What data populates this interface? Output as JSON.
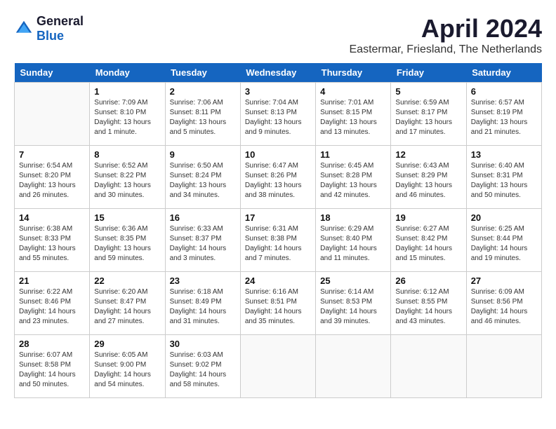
{
  "header": {
    "logo_general": "General",
    "logo_blue": "Blue",
    "month_year": "April 2024",
    "location": "Eastermar, Friesland, The Netherlands"
  },
  "weekdays": [
    "Sunday",
    "Monday",
    "Tuesday",
    "Wednesday",
    "Thursday",
    "Friday",
    "Saturday"
  ],
  "weeks": [
    [
      {
        "day": "",
        "sunrise": "",
        "sunset": "",
        "daylight": ""
      },
      {
        "day": "1",
        "sunrise": "Sunrise: 7:09 AM",
        "sunset": "Sunset: 8:10 PM",
        "daylight": "Daylight: 13 hours and 1 minute."
      },
      {
        "day": "2",
        "sunrise": "Sunrise: 7:06 AM",
        "sunset": "Sunset: 8:11 PM",
        "daylight": "Daylight: 13 hours and 5 minutes."
      },
      {
        "day": "3",
        "sunrise": "Sunrise: 7:04 AM",
        "sunset": "Sunset: 8:13 PM",
        "daylight": "Daylight: 13 hours and 9 minutes."
      },
      {
        "day": "4",
        "sunrise": "Sunrise: 7:01 AM",
        "sunset": "Sunset: 8:15 PM",
        "daylight": "Daylight: 13 hours and 13 minutes."
      },
      {
        "day": "5",
        "sunrise": "Sunrise: 6:59 AM",
        "sunset": "Sunset: 8:17 PM",
        "daylight": "Daylight: 13 hours and 17 minutes."
      },
      {
        "day": "6",
        "sunrise": "Sunrise: 6:57 AM",
        "sunset": "Sunset: 8:19 PM",
        "daylight": "Daylight: 13 hours and 21 minutes."
      }
    ],
    [
      {
        "day": "7",
        "sunrise": "Sunrise: 6:54 AM",
        "sunset": "Sunset: 8:20 PM",
        "daylight": "Daylight: 13 hours and 26 minutes."
      },
      {
        "day": "8",
        "sunrise": "Sunrise: 6:52 AM",
        "sunset": "Sunset: 8:22 PM",
        "daylight": "Daylight: 13 hours and 30 minutes."
      },
      {
        "day": "9",
        "sunrise": "Sunrise: 6:50 AM",
        "sunset": "Sunset: 8:24 PM",
        "daylight": "Daylight: 13 hours and 34 minutes."
      },
      {
        "day": "10",
        "sunrise": "Sunrise: 6:47 AM",
        "sunset": "Sunset: 8:26 PM",
        "daylight": "Daylight: 13 hours and 38 minutes."
      },
      {
        "day": "11",
        "sunrise": "Sunrise: 6:45 AM",
        "sunset": "Sunset: 8:28 PM",
        "daylight": "Daylight: 13 hours and 42 minutes."
      },
      {
        "day": "12",
        "sunrise": "Sunrise: 6:43 AM",
        "sunset": "Sunset: 8:29 PM",
        "daylight": "Daylight: 13 hours and 46 minutes."
      },
      {
        "day": "13",
        "sunrise": "Sunrise: 6:40 AM",
        "sunset": "Sunset: 8:31 PM",
        "daylight": "Daylight: 13 hours and 50 minutes."
      }
    ],
    [
      {
        "day": "14",
        "sunrise": "Sunrise: 6:38 AM",
        "sunset": "Sunset: 8:33 PM",
        "daylight": "Daylight: 13 hours and 55 minutes."
      },
      {
        "day": "15",
        "sunrise": "Sunrise: 6:36 AM",
        "sunset": "Sunset: 8:35 PM",
        "daylight": "Daylight: 13 hours and 59 minutes."
      },
      {
        "day": "16",
        "sunrise": "Sunrise: 6:33 AM",
        "sunset": "Sunset: 8:37 PM",
        "daylight": "Daylight: 14 hours and 3 minutes."
      },
      {
        "day": "17",
        "sunrise": "Sunrise: 6:31 AM",
        "sunset": "Sunset: 8:38 PM",
        "daylight": "Daylight: 14 hours and 7 minutes."
      },
      {
        "day": "18",
        "sunrise": "Sunrise: 6:29 AM",
        "sunset": "Sunset: 8:40 PM",
        "daylight": "Daylight: 14 hours and 11 minutes."
      },
      {
        "day": "19",
        "sunrise": "Sunrise: 6:27 AM",
        "sunset": "Sunset: 8:42 PM",
        "daylight": "Daylight: 14 hours and 15 minutes."
      },
      {
        "day": "20",
        "sunrise": "Sunrise: 6:25 AM",
        "sunset": "Sunset: 8:44 PM",
        "daylight": "Daylight: 14 hours and 19 minutes."
      }
    ],
    [
      {
        "day": "21",
        "sunrise": "Sunrise: 6:22 AM",
        "sunset": "Sunset: 8:46 PM",
        "daylight": "Daylight: 14 hours and 23 minutes."
      },
      {
        "day": "22",
        "sunrise": "Sunrise: 6:20 AM",
        "sunset": "Sunset: 8:47 PM",
        "daylight": "Daylight: 14 hours and 27 minutes."
      },
      {
        "day": "23",
        "sunrise": "Sunrise: 6:18 AM",
        "sunset": "Sunset: 8:49 PM",
        "daylight": "Daylight: 14 hours and 31 minutes."
      },
      {
        "day": "24",
        "sunrise": "Sunrise: 6:16 AM",
        "sunset": "Sunset: 8:51 PM",
        "daylight": "Daylight: 14 hours and 35 minutes."
      },
      {
        "day": "25",
        "sunrise": "Sunrise: 6:14 AM",
        "sunset": "Sunset: 8:53 PM",
        "daylight": "Daylight: 14 hours and 39 minutes."
      },
      {
        "day": "26",
        "sunrise": "Sunrise: 6:12 AM",
        "sunset": "Sunset: 8:55 PM",
        "daylight": "Daylight: 14 hours and 43 minutes."
      },
      {
        "day": "27",
        "sunrise": "Sunrise: 6:09 AM",
        "sunset": "Sunset: 8:56 PM",
        "daylight": "Daylight: 14 hours and 46 minutes."
      }
    ],
    [
      {
        "day": "28",
        "sunrise": "Sunrise: 6:07 AM",
        "sunset": "Sunset: 8:58 PM",
        "daylight": "Daylight: 14 hours and 50 minutes."
      },
      {
        "day": "29",
        "sunrise": "Sunrise: 6:05 AM",
        "sunset": "Sunset: 9:00 PM",
        "daylight": "Daylight: 14 hours and 54 minutes."
      },
      {
        "day": "30",
        "sunrise": "Sunrise: 6:03 AM",
        "sunset": "Sunset: 9:02 PM",
        "daylight": "Daylight: 14 hours and 58 minutes."
      },
      {
        "day": "",
        "sunrise": "",
        "sunset": "",
        "daylight": ""
      },
      {
        "day": "",
        "sunrise": "",
        "sunset": "",
        "daylight": ""
      },
      {
        "day": "",
        "sunrise": "",
        "sunset": "",
        "daylight": ""
      },
      {
        "day": "",
        "sunrise": "",
        "sunset": "",
        "daylight": ""
      }
    ]
  ]
}
